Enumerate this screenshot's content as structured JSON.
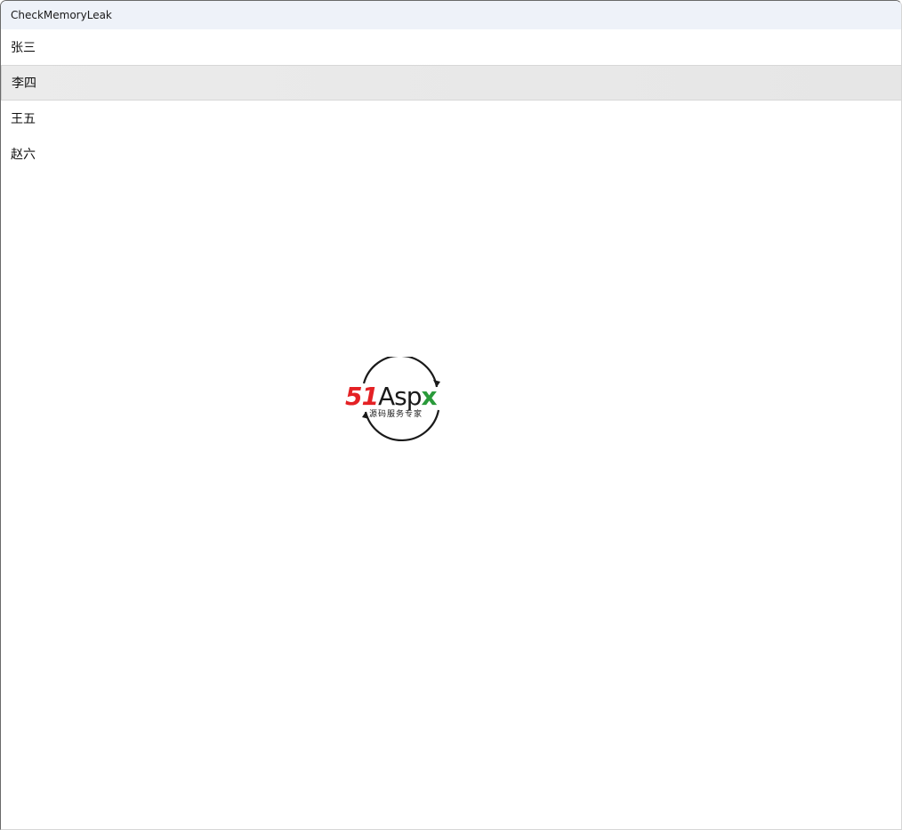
{
  "window": {
    "title": "CheckMemoryLeak"
  },
  "list": {
    "items": [
      {
        "label": "张三",
        "selected": false
      },
      {
        "label": "李四",
        "selected": true
      },
      {
        "label": "王五",
        "selected": false
      },
      {
        "label": "赵六",
        "selected": false
      }
    ]
  },
  "watermark": {
    "brand_number": "51",
    "brand_a": "A",
    "brand_sp": "sp",
    "brand_x": "x",
    "tagline": "源码服务专家",
    "colors": {
      "red": "#e42124",
      "green": "#2a9a3a",
      "dark": "#1a1a1a"
    }
  }
}
